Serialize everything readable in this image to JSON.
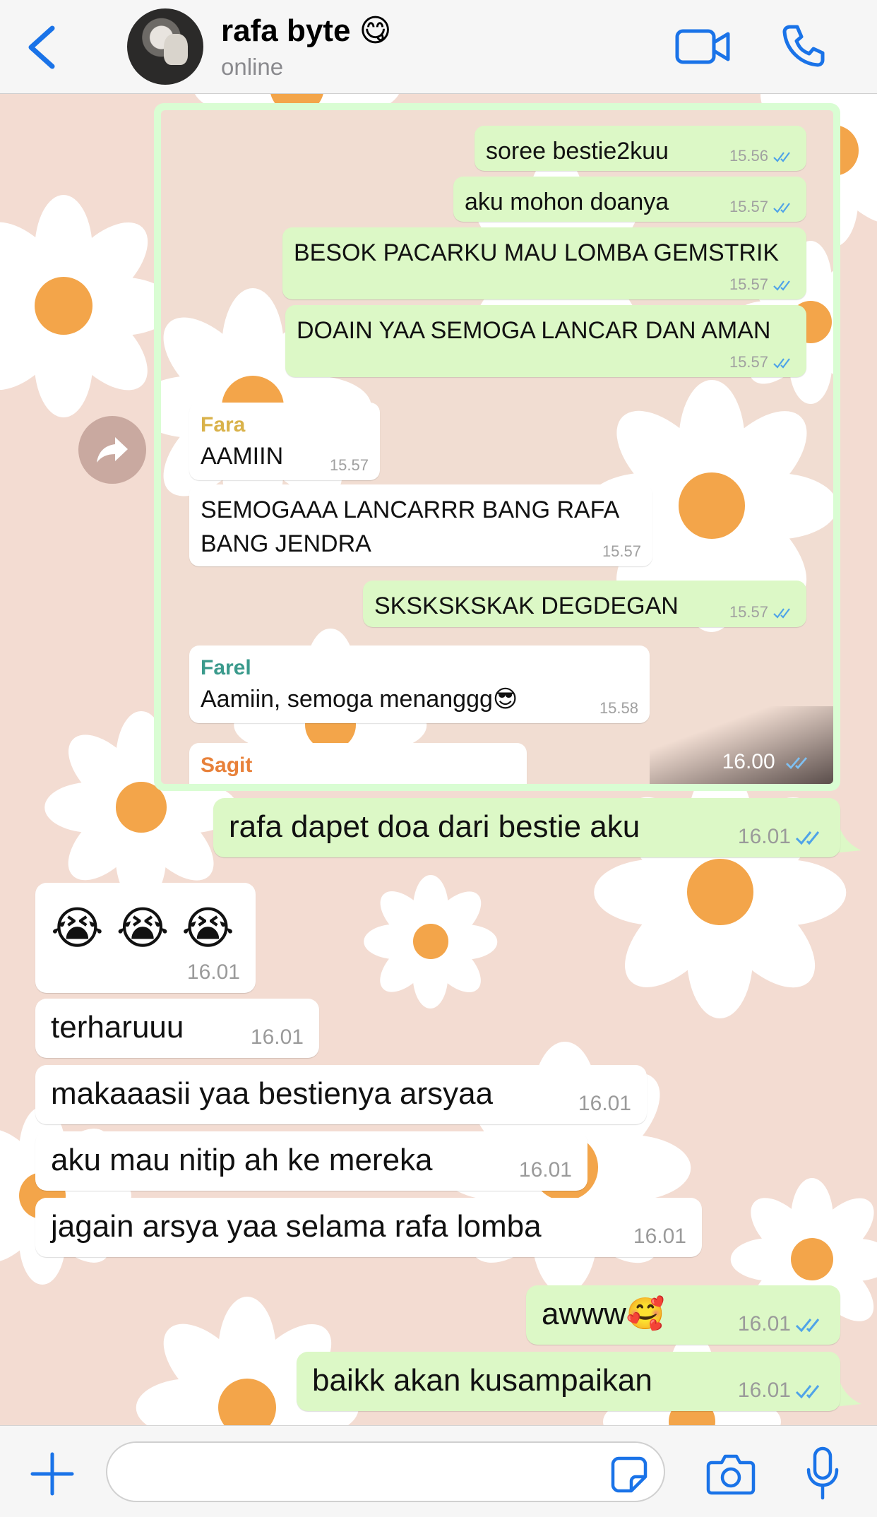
{
  "header": {
    "contact_name": "rafa byte 😋",
    "status": "online",
    "icons": [
      "chevron-left-icon",
      "avatar",
      "video-camera-icon",
      "phone-icon"
    ]
  },
  "forwarded_screenshot": {
    "time": "16.00",
    "messages": [
      {
        "dir": "out",
        "text": "soree bestie2kuu",
        "time": "15.56"
      },
      {
        "dir": "out",
        "text": "aku mohon doanya",
        "time": "15.57"
      },
      {
        "dir": "out",
        "text": "BESOK PACARKU MAU LOMBA GEMSTRIK",
        "time": "15.57"
      },
      {
        "dir": "out",
        "text": "DOAIN YAA SEMOGA LANCAR DAN AMAN",
        "time": "15.57"
      },
      {
        "dir": "in",
        "sender": "Fara",
        "text": "AAMIIN",
        "time": "15.57"
      },
      {
        "dir": "in",
        "text_line1": "SEMOGAAA LANCARRR BANG RAFA",
        "text_line2": "BANG JENDRA",
        "time": "15.57"
      },
      {
        "dir": "out",
        "text": "SKSKSKSKAK DEGDEGAN",
        "time": "15.57"
      },
      {
        "dir": "in",
        "sender": "Farel",
        "text": "Aamiin, semoga menanggg😎",
        "time": "15.58"
      },
      {
        "dir": "in",
        "sender": "Sagit",
        "text": "",
        "time": ""
      }
    ],
    "sender_colors": {
      "Fara": "#d9b24a",
      "Farel": "#3a9a8c",
      "Sagit": "#e8813a"
    }
  },
  "messages": [
    {
      "dir": "out",
      "text": "rafa dapet doa dari bestie aku",
      "time": "16.01"
    },
    {
      "dir": "in",
      "text": "😭 😭 😭",
      "time": "16.01"
    },
    {
      "dir": "in",
      "text": "terharuuu",
      "time": "16.01"
    },
    {
      "dir": "in",
      "text": "makaaasii yaa bestienya arsyaa",
      "time": "16.01"
    },
    {
      "dir": "in",
      "text": "aku mau nitip ah ke mereka",
      "time": "16.01"
    },
    {
      "dir": "in",
      "text": "jagain arsya yaa selama rafa lomba",
      "time": "16.01"
    },
    {
      "dir": "out",
      "text": "awww🥰",
      "time": "16.01"
    },
    {
      "dir": "out",
      "text": "baikk akan kusampaikan",
      "time": "16.01"
    }
  ],
  "input_bar": {
    "placeholder": "",
    "icons": [
      "plus-icon",
      "sticker-icon",
      "camera-icon",
      "microphone-icon"
    ]
  },
  "colors": {
    "accent": "#1a73e8",
    "outgoing_bubble": "#dcf8c6",
    "incoming_bubble": "#ffffff",
    "read_ticks": "#4fa3e8",
    "wallpaper": "#f3dcd2",
    "daisy_center": "#f3a54a"
  }
}
